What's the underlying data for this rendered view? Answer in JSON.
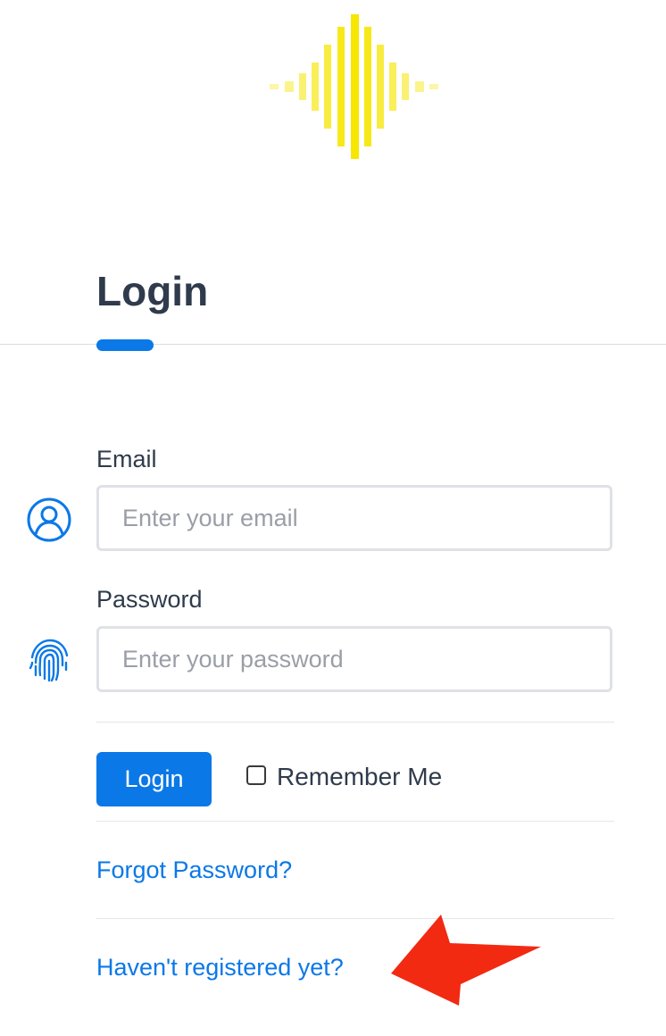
{
  "page": {
    "title": "Login"
  },
  "form": {
    "email": {
      "label": "Email",
      "placeholder": "Enter your email",
      "value": ""
    },
    "password": {
      "label": "Password",
      "placeholder": "Enter your password",
      "value": ""
    },
    "submit_label": "Login",
    "remember_label": "Remember Me",
    "remember_checked": false
  },
  "links": {
    "forgot": "Forgot Password?",
    "register": "Haven't registered yet?"
  },
  "icons": {
    "logo": "sound-wave-icon",
    "email": "user-circle-icon",
    "password": "fingerprint-icon",
    "annotation": "arrow-pointer-icon"
  },
  "colors": {
    "accent": "#0b78e7",
    "logo": "#f6e600",
    "annotation_arrow": "#f22a12",
    "text": "#2f3b4c"
  }
}
